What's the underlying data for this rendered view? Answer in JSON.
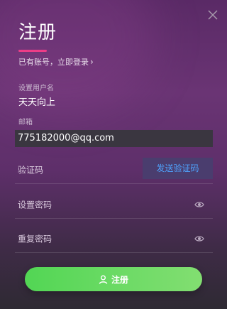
{
  "dialog": {
    "title": "注册",
    "login_link": "已有账号，立即登录",
    "accent_color": "#ec3d87"
  },
  "username": {
    "label": "设置用户名",
    "value": "天天向上"
  },
  "email": {
    "label": "邮箱",
    "value": "775182000@qq.com"
  },
  "verification": {
    "label": "验证码",
    "send_button": "发送验证码",
    "button_color": "#4fa4ff"
  },
  "password": {
    "label": "设置密码",
    "icon": "eye-icon"
  },
  "confirm_password": {
    "label": "重复密码",
    "icon": "eye-icon"
  },
  "submit": {
    "label": "注册",
    "icon": "user-icon",
    "color": "#5ad85a"
  },
  "close": {
    "icon": "close-icon"
  }
}
